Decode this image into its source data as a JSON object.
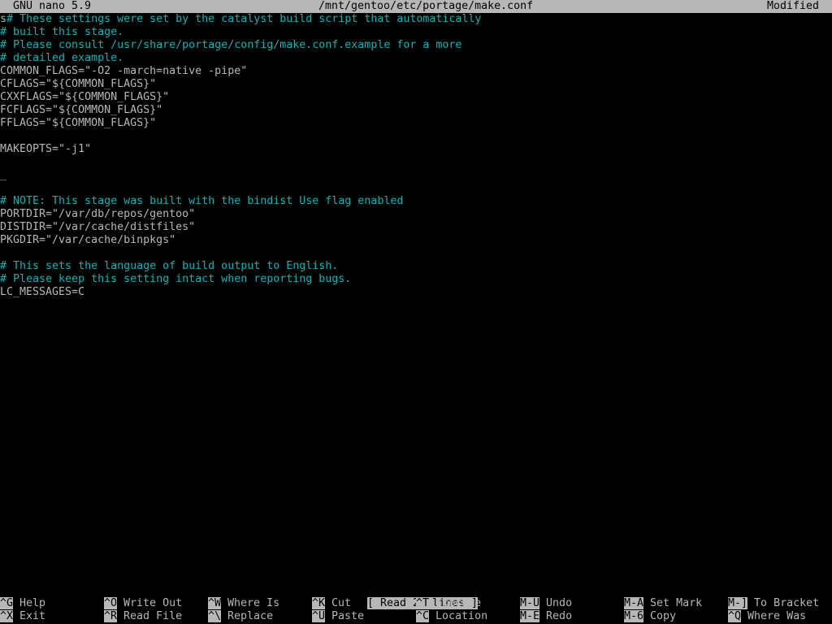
{
  "titlebar": {
    "app": "GNU nano 5.9",
    "file": "/mnt/gentoo/etc/portage/make.conf",
    "state": "Modified"
  },
  "editor": {
    "lines": [
      {
        "text": "s# These settings were set by the catalyst build script that automatically",
        "type": "mixed"
      },
      {
        "text": "# built this stage.",
        "type": "comment"
      },
      {
        "text": "# Please consult /usr/share/portage/config/make.conf.example for a more",
        "type": "comment"
      },
      {
        "text": "# detailed example.",
        "type": "comment"
      },
      {
        "text": "COMMON_FLAGS=\"-O2 -march=native -pipe\"",
        "type": "plain"
      },
      {
        "text": "CFLAGS=\"${COMMON_FLAGS}\"",
        "type": "plain"
      },
      {
        "text": "CXXFLAGS=\"${COMMON_FLAGS}\"",
        "type": "plain"
      },
      {
        "text": "FCFLAGS=\"${COMMON_FLAGS}\"",
        "type": "plain"
      },
      {
        "text": "FFLAGS=\"${COMMON_FLAGS}\"",
        "type": "plain"
      },
      {
        "text": "",
        "type": "plain"
      },
      {
        "text": "MAKEOPTS=\"-j1\"",
        "type": "plain"
      },
      {
        "text": "",
        "type": "plain"
      },
      {
        "text": "_",
        "type": "cursor"
      },
      {
        "text": "",
        "type": "plain"
      },
      {
        "text": "# NOTE: This stage was built with the bindist Use flag enabled",
        "type": "comment"
      },
      {
        "text": "PORTDIR=\"/var/db/repos/gentoo\"",
        "type": "plain"
      },
      {
        "text": "DISTDIR=\"/var/cache/distfiles\"",
        "type": "plain"
      },
      {
        "text": "PKGDIR=\"/var/cache/binpkgs\"",
        "type": "plain"
      },
      {
        "text": "",
        "type": "plain"
      },
      {
        "text": "# This sets the language of build output to English.",
        "type": "comment"
      },
      {
        "text": "# Please keep this setting intact when reporting bugs.",
        "type": "comment"
      },
      {
        "text": "LC_MESSAGES=C",
        "type": "plain"
      }
    ]
  },
  "status_message": "[ Read 20 lines ]",
  "shortcuts": {
    "row1": [
      {
        "key": "^G",
        "label": "Help"
      },
      {
        "key": "^O",
        "label": "Write Out"
      },
      {
        "key": "^W",
        "label": "Where Is"
      },
      {
        "key": "^K",
        "label": "Cut"
      },
      {
        "key": "^T",
        "label": "Execute"
      },
      {
        "key": "M-U",
        "label": "Undo"
      },
      {
        "key": "M-A",
        "label": "Set Mark"
      },
      {
        "key": "M-]",
        "label": "To Bracket"
      }
    ],
    "row2": [
      {
        "key": "^X",
        "label": "Exit"
      },
      {
        "key": "^R",
        "label": "Read File"
      },
      {
        "key": "^\\",
        "label": "Replace"
      },
      {
        "key": "^U",
        "label": "Paste"
      },
      {
        "key": "^C",
        "label": "Location"
      },
      {
        "key": "M-E",
        "label": "Redo"
      },
      {
        "key": "M-6",
        "label": "Copy"
      },
      {
        "key": "^Q",
        "label": "Where Was"
      }
    ]
  },
  "colors": {
    "comment": "#18b2b2",
    "text": "#b7b7b7",
    "background": "#000000",
    "bar": "#b7b7b7"
  }
}
